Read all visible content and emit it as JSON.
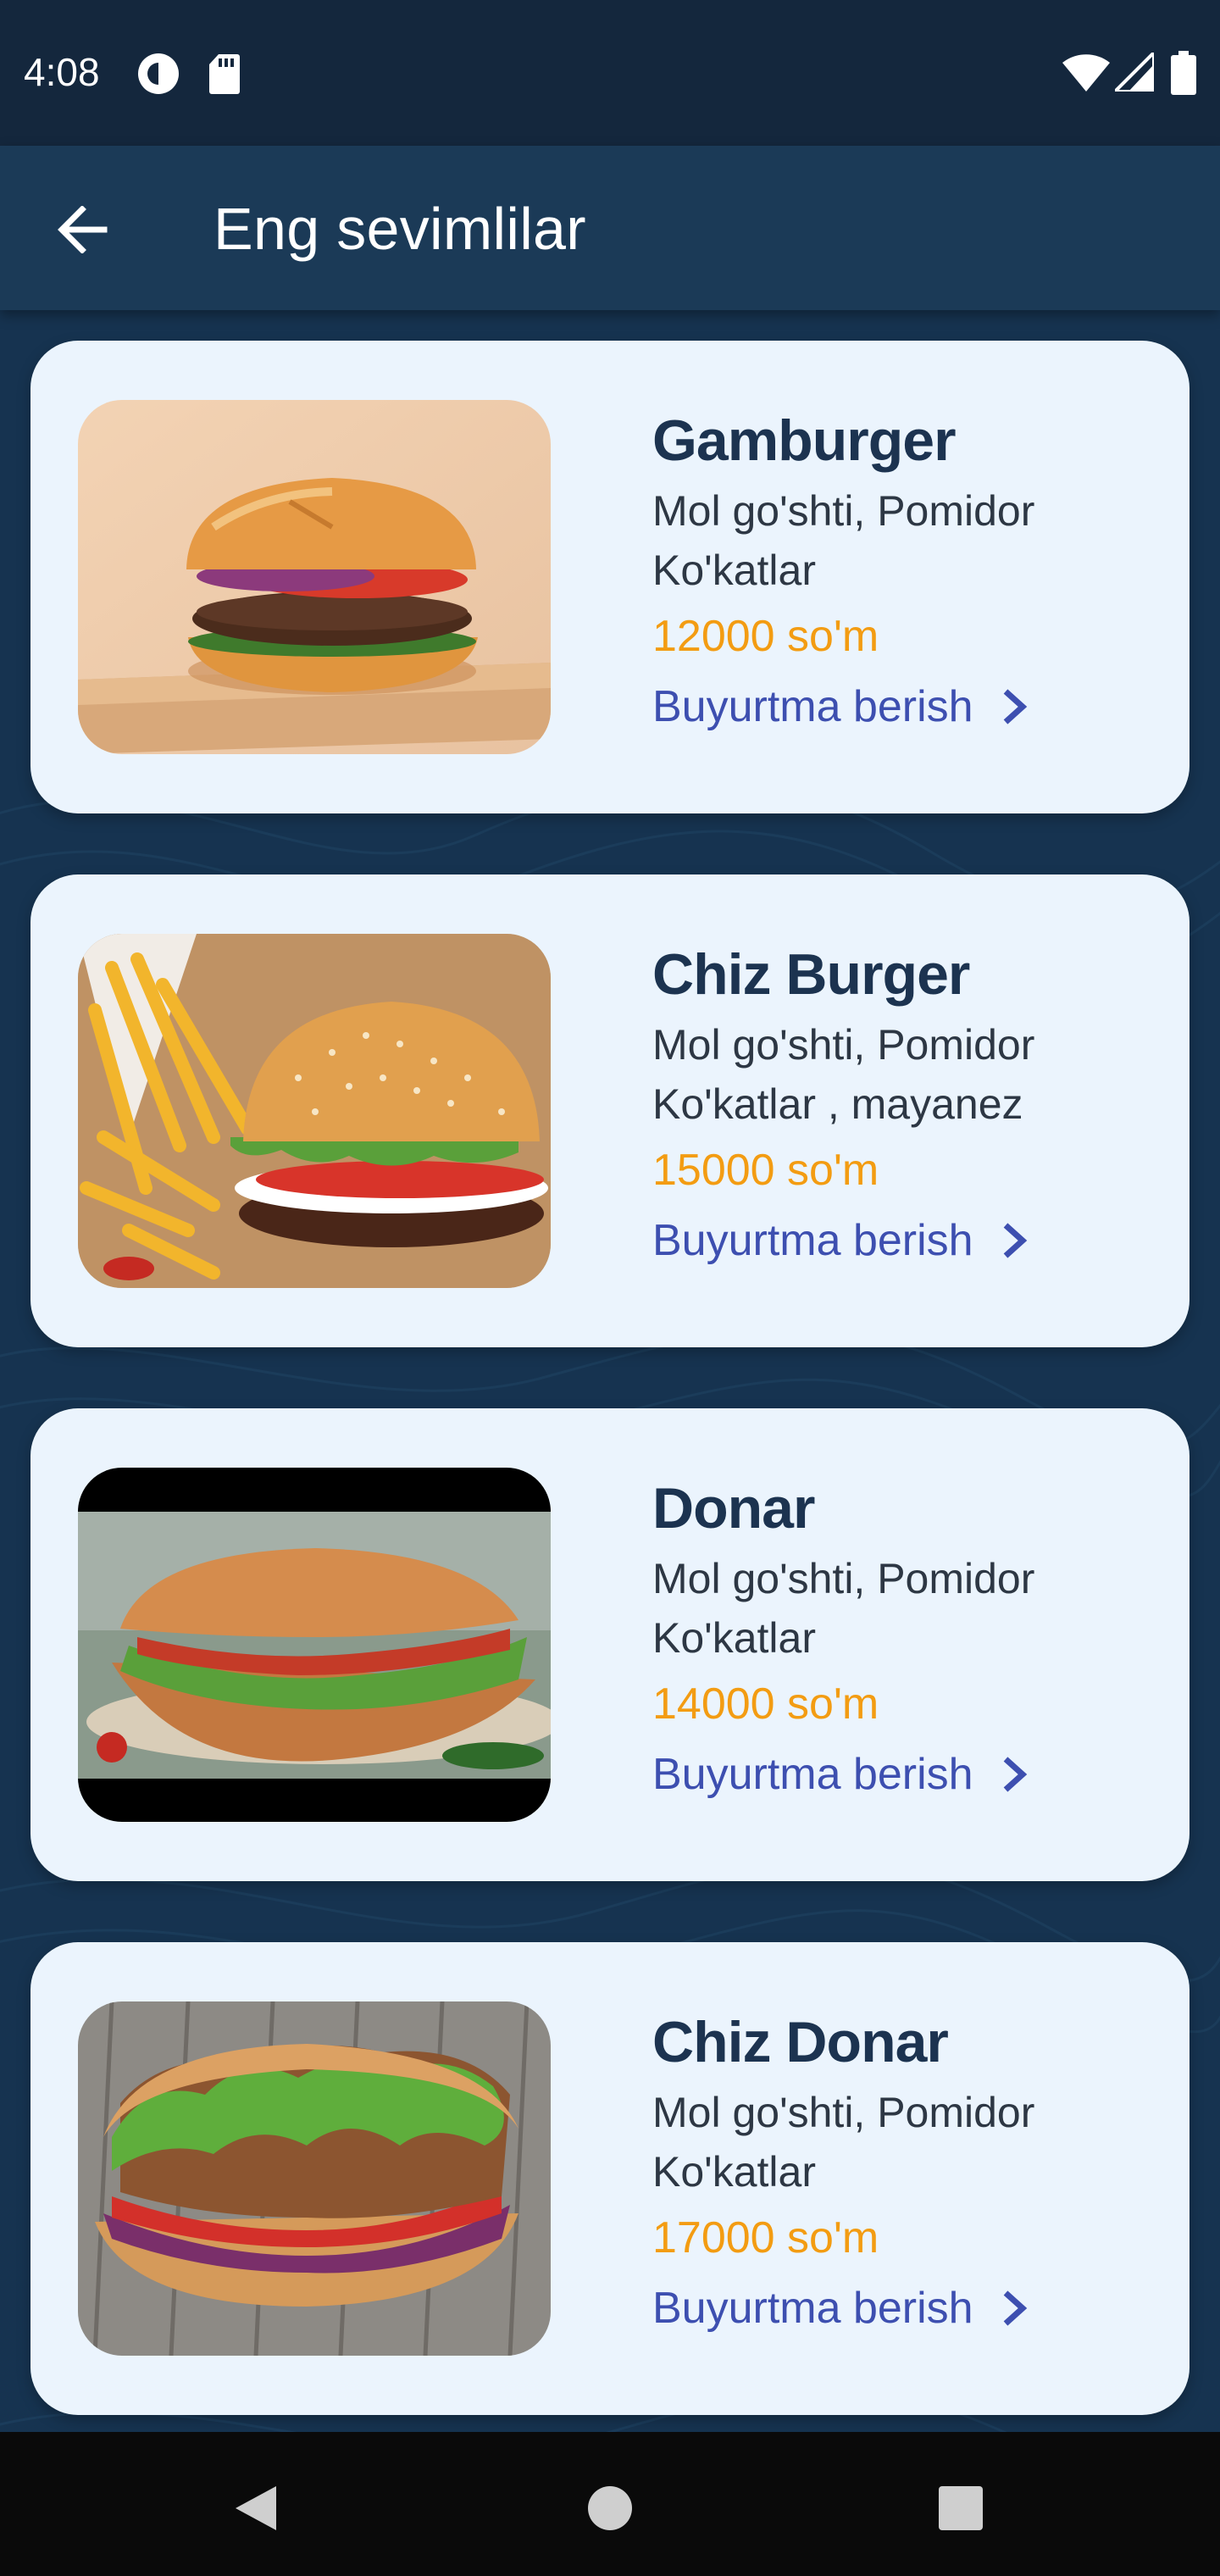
{
  "status_bar": {
    "time": "4:08",
    "icons": [
      "pocket-casts-icon",
      "sd-card-icon",
      "wifi-icon",
      "signal-icon",
      "battery-icon"
    ]
  },
  "app_bar": {
    "title": "Eng sevimlilar",
    "back_icon": "arrow-left-icon"
  },
  "colors": {
    "status_bar": "#14273d",
    "app_bar": "#1b3a57",
    "background": "#163350",
    "card": "#ebf4fd",
    "title_text": "#1c3350",
    "price": "#f39c12",
    "link": "#3d4fb0",
    "nav_bar": "#0a0a0a"
  },
  "items": [
    {
      "name": "Gamburger",
      "desc_line1": "Mol go'shti, Pomidor",
      "desc_line2": "Ko'katlar",
      "price": "12000 so'm",
      "order_label": "Buyurtma berish"
    },
    {
      "name": "Chiz Burger",
      "desc_line1": "Mol go'shti, Pomidor",
      "desc_line2": "Ko'katlar , mayanez",
      "price": "15000 so'm",
      "order_label": "Buyurtma berish"
    },
    {
      "name": "Donar",
      "desc_line1": "Mol go'shti, Pomidor",
      "desc_line2": "Ko'katlar",
      "price": "14000 so'm",
      "order_label": "Buyurtma berish"
    },
    {
      "name": "Chiz Donar",
      "desc_line1": "Mol go'shti, Pomidor",
      "desc_line2": "Ko'katlar",
      "price": "17000 so'm",
      "order_label": "Buyurtma berish"
    }
  ],
  "nav_bar": {
    "icons": [
      "back-triangle-icon",
      "home-circle-icon",
      "recents-square-icon"
    ]
  }
}
